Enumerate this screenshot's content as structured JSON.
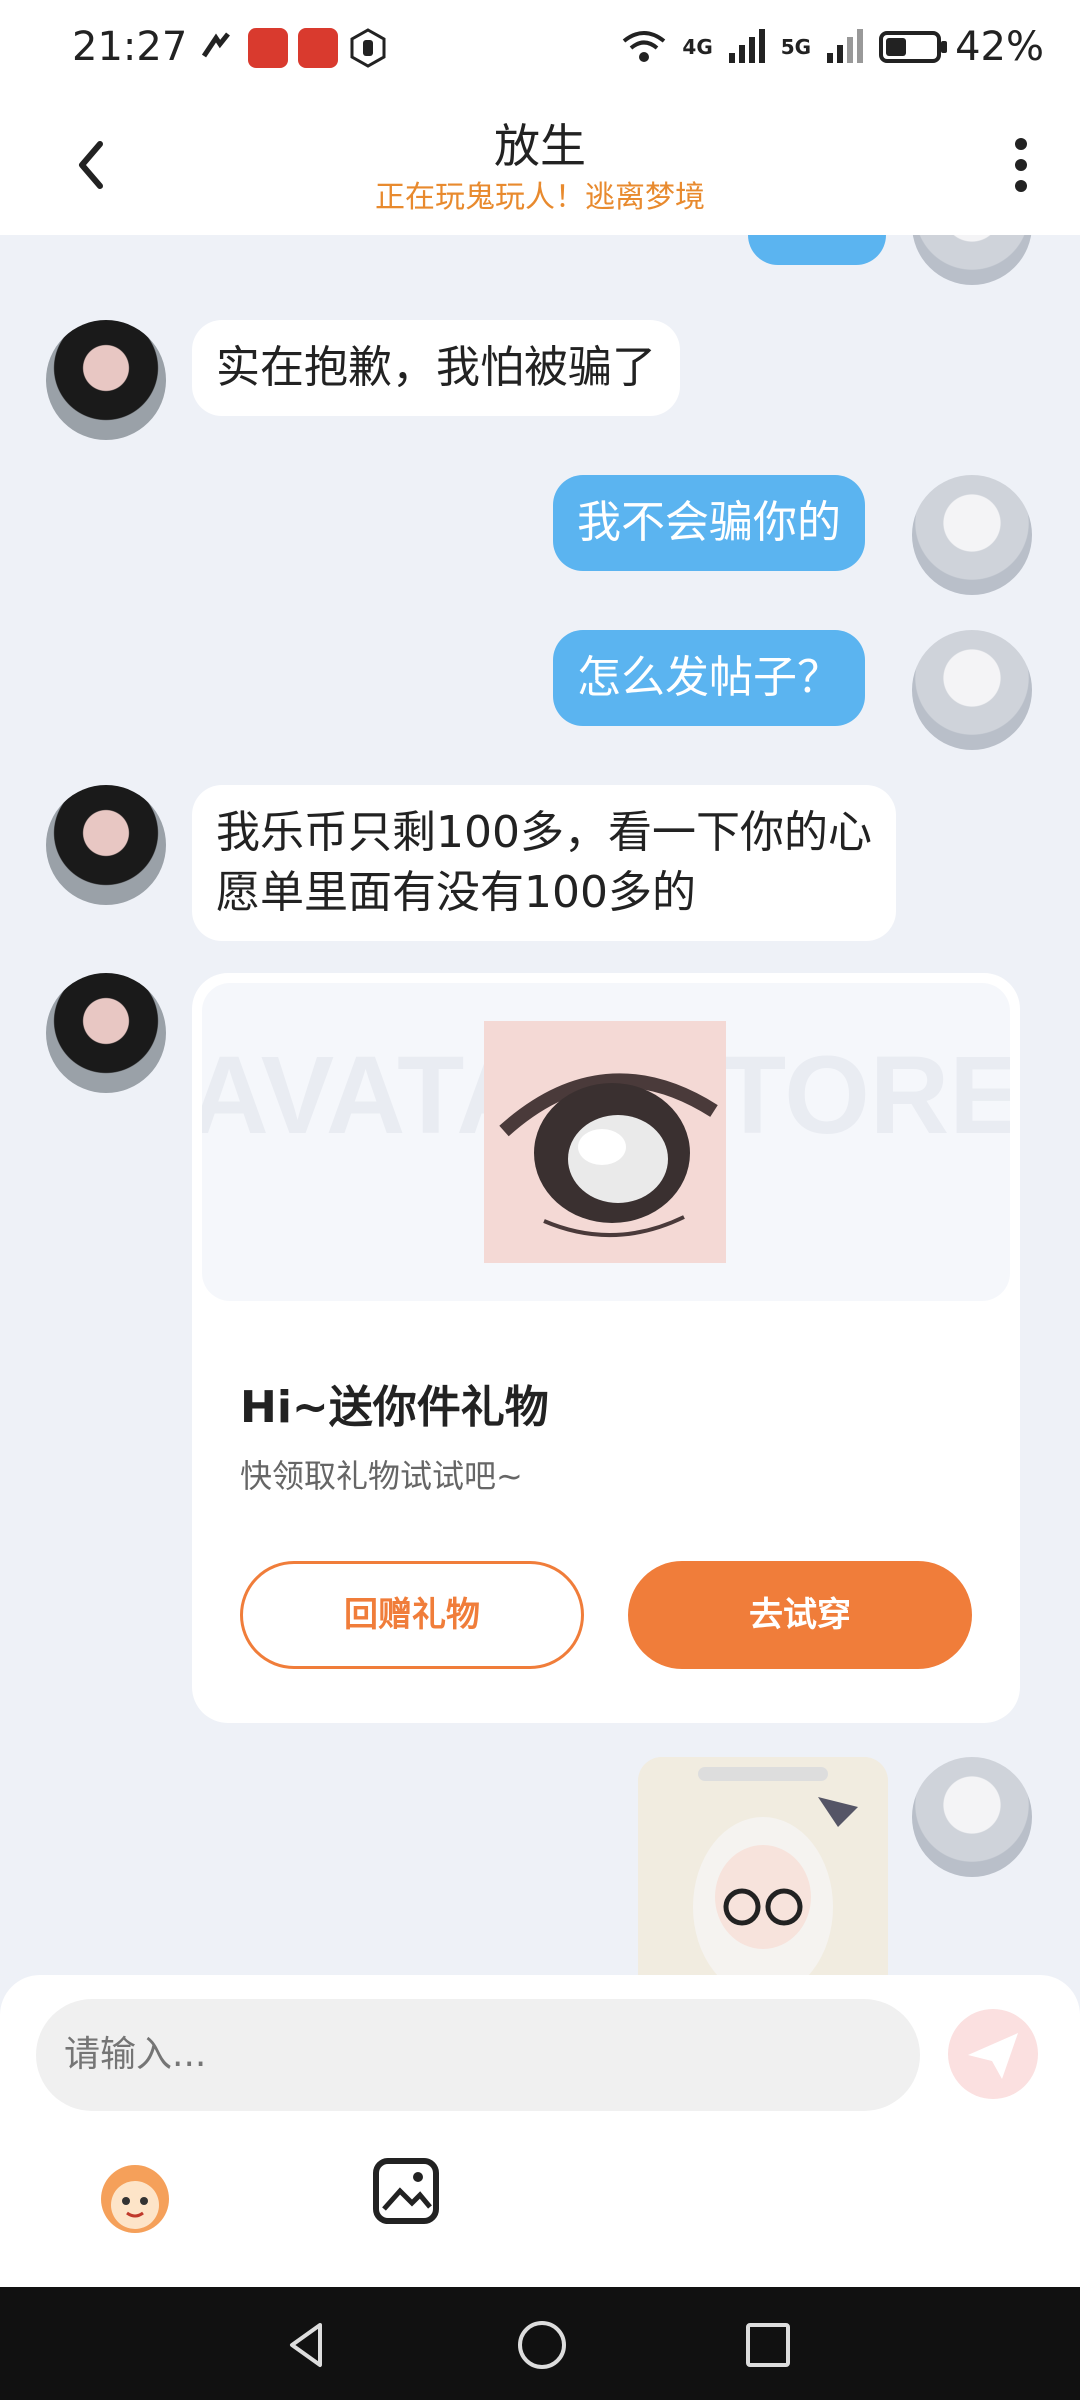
{
  "status_bar": {
    "time": "21:27",
    "signal_4g": "4G",
    "signal_5g": "5G",
    "battery_percent_text": "42%",
    "battery_level": 0.42
  },
  "header": {
    "title": "放生",
    "subtitle": "正在玩鬼玩人！逃离梦境"
  },
  "messages": [
    {
      "from": "other",
      "text": "实在抱歉，我怕被骗了"
    },
    {
      "from": "self",
      "text": "我不会骗你的"
    },
    {
      "from": "self",
      "text": "怎么发帖子？"
    },
    {
      "from": "other",
      "text": "我乐币只剩100多，看一下你的心愿单里面有没有100多的"
    }
  ],
  "gift_card": {
    "watermark": "AVATAR STORE",
    "title": "Hi~送你件礼物",
    "subtitle": "快领取礼物试试吧~",
    "return_button": "回赠礼物",
    "try_button": "去试穿"
  },
  "input": {
    "placeholder": "请输入..."
  },
  "colors": {
    "accent_orange": "#f07d3a",
    "subtitle_orange": "#e88a2e",
    "self_bubble": "#5bb4f0",
    "chat_bg": "#eef1f7"
  }
}
